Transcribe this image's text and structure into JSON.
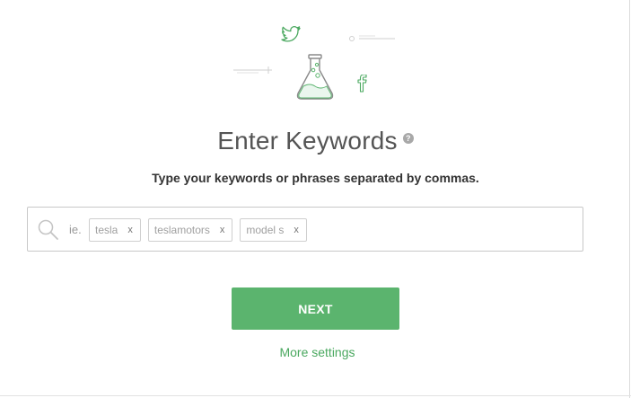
{
  "header": {
    "title": "Enter Keywords",
    "help_icon": "question-circle-icon",
    "help_glyph": "?"
  },
  "illustration": {
    "icons": [
      "twitter-icon",
      "flask-icon",
      "facebook-icon"
    ],
    "facebook_glyph": "f"
  },
  "instructions": "Type your keywords or phrases separated by commas.",
  "keyword_input": {
    "placeholder": "ie.",
    "tags": [
      {
        "label": "tesla",
        "remove": "x"
      },
      {
        "label": "teslamotors",
        "remove": "x"
      },
      {
        "label": "model s",
        "remove": "x"
      }
    ]
  },
  "actions": {
    "next_label": "NEXT",
    "more_settings_label": "More settings"
  },
  "colors": {
    "accent": "#5bb46e",
    "link": "#4aa85f",
    "text": "#333333",
    "muted": "#a0a0a0"
  }
}
